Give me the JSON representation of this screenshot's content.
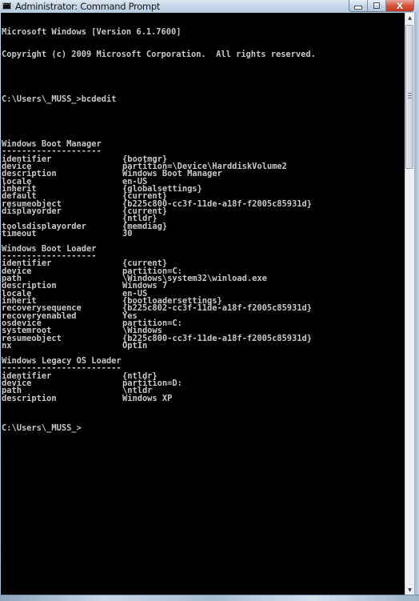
{
  "window": {
    "title": "Administrator: Command Prompt",
    "icon": "cmd-icon",
    "controls": {
      "minimize": "minimize-icon",
      "maximize": "restore-icon",
      "close_glyph": "X"
    }
  },
  "console": {
    "header": [
      "Microsoft Windows [Version 6.1.7600]",
      "Copyright (c) 2009 Microsoft Corporation.  All rights reserved."
    ],
    "command_prompt": "C:\\Users\\_MUSS_>",
    "command": "bcdedit",
    "sections": [
      {
        "title": "Windows Boot Manager",
        "underline": "--------------------",
        "entries": [
          {
            "key": "identifier",
            "value": "{bootmgr}"
          },
          {
            "key": "device",
            "value": "partition=\\Device\\HarddiskVolume2"
          },
          {
            "key": "description",
            "value": "Windows Boot Manager"
          },
          {
            "key": "locale",
            "value": "en-US"
          },
          {
            "key": "inherit",
            "value": "{globalsettings}"
          },
          {
            "key": "default",
            "value": "{current}"
          },
          {
            "key": "resumeobject",
            "value": "{b225c800-cc3f-11de-a18f-f2005c85931d}"
          },
          {
            "key": "displayorder",
            "value": "{current}"
          },
          {
            "key": "",
            "value": "{ntldr}"
          },
          {
            "key": "toolsdisplayorder",
            "value": "{memdiag}"
          },
          {
            "key": "timeout",
            "value": "30"
          }
        ]
      },
      {
        "title": "Windows Boot Loader",
        "underline": "-------------------",
        "entries": [
          {
            "key": "identifier",
            "value": "{current}"
          },
          {
            "key": "device",
            "value": "partition=C:"
          },
          {
            "key": "path",
            "value": "\\Windows\\system32\\winload.exe"
          },
          {
            "key": "description",
            "value": "Windows 7"
          },
          {
            "key": "locale",
            "value": "en-US"
          },
          {
            "key": "inherit",
            "value": "{bootloadersettings}"
          },
          {
            "key": "recoverysequence",
            "value": "{b225c802-cc3f-11de-a18f-f2005c85931d}"
          },
          {
            "key": "recoveryenabled",
            "value": "Yes"
          },
          {
            "key": "osdevice",
            "value": "partition=C:"
          },
          {
            "key": "systemroot",
            "value": "\\Windows"
          },
          {
            "key": "resumeobject",
            "value": "{b225c800-cc3f-11de-a18f-f2005c85931d}"
          },
          {
            "key": "nx",
            "value": "OptIn"
          }
        ]
      },
      {
        "title": "Windows Legacy OS Loader",
        "underline": "------------------------",
        "entries": [
          {
            "key": "identifier",
            "value": "{ntldr}"
          },
          {
            "key": "device",
            "value": "partition=D:"
          },
          {
            "key": "path",
            "value": "\\ntldr"
          },
          {
            "key": "description",
            "value": "Windows XP"
          }
        ]
      }
    ],
    "final_prompt": "C:\\Users\\_MUSS_>"
  },
  "scrollbar": {
    "up_arrow": "▲",
    "down_arrow": "▼"
  },
  "colors": {
    "console_background": "#000000",
    "console_text": "#c0c0c0",
    "close_button": "#d7553b"
  }
}
